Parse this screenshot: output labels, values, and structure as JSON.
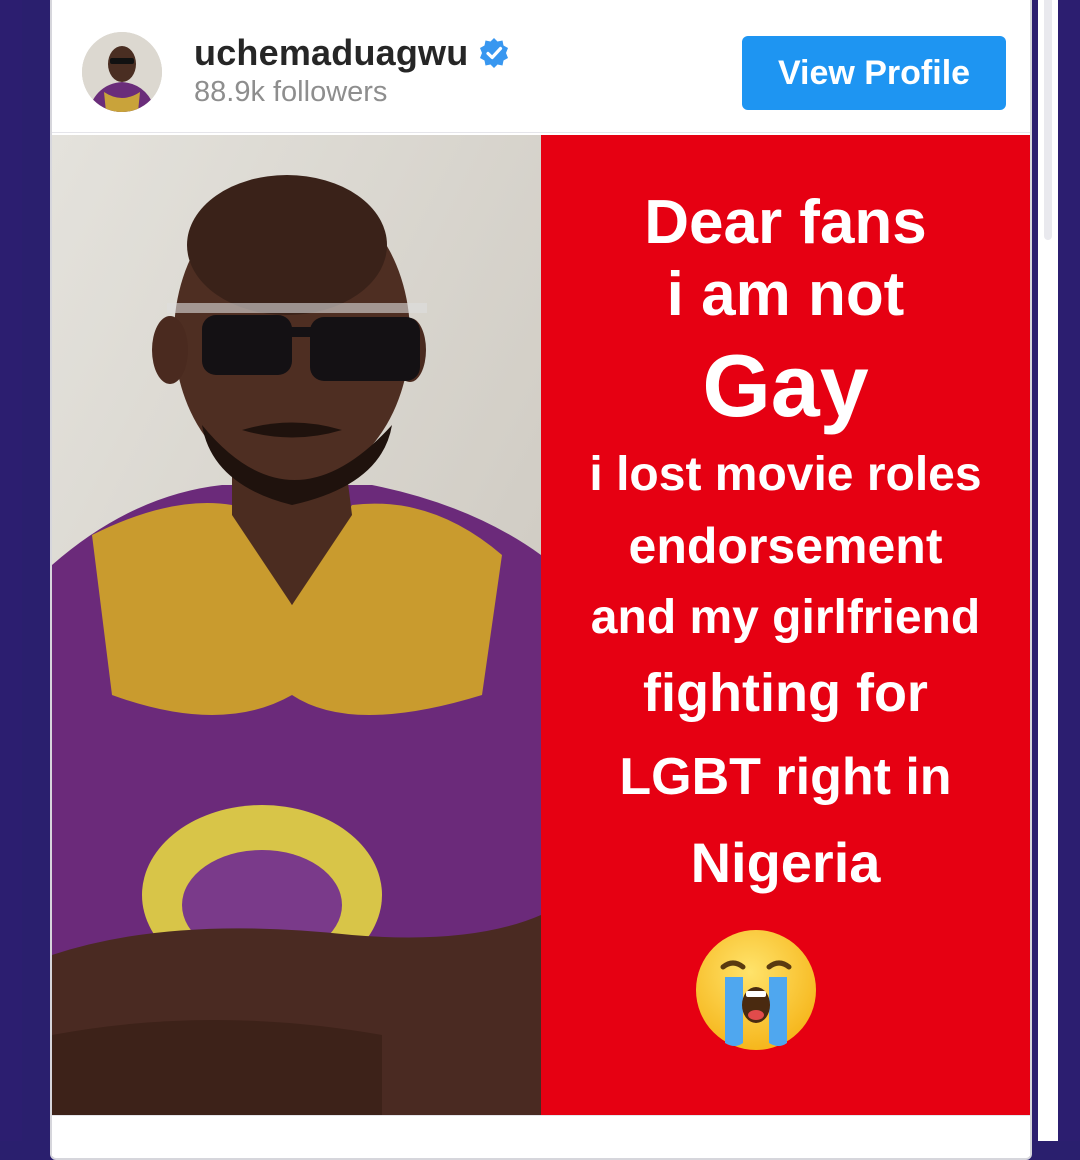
{
  "profile": {
    "username": "uchemaduagwu",
    "followers": "88.9k followers",
    "verified": true,
    "view_profile_label": "View Profile"
  },
  "post": {
    "text_lines": [
      "Dear fans",
      "i am not",
      "Gay",
      "i lost movie roles",
      "endorsement",
      "and my girlfriend",
      "fighting for",
      "LGBT right in",
      "Nigeria"
    ],
    "emoji": "loudly-crying-face"
  },
  "colors": {
    "button": "#1e95f2",
    "verified_badge": "#3897f0",
    "panel_red": "#e60012",
    "frame": "#2c1e70"
  }
}
